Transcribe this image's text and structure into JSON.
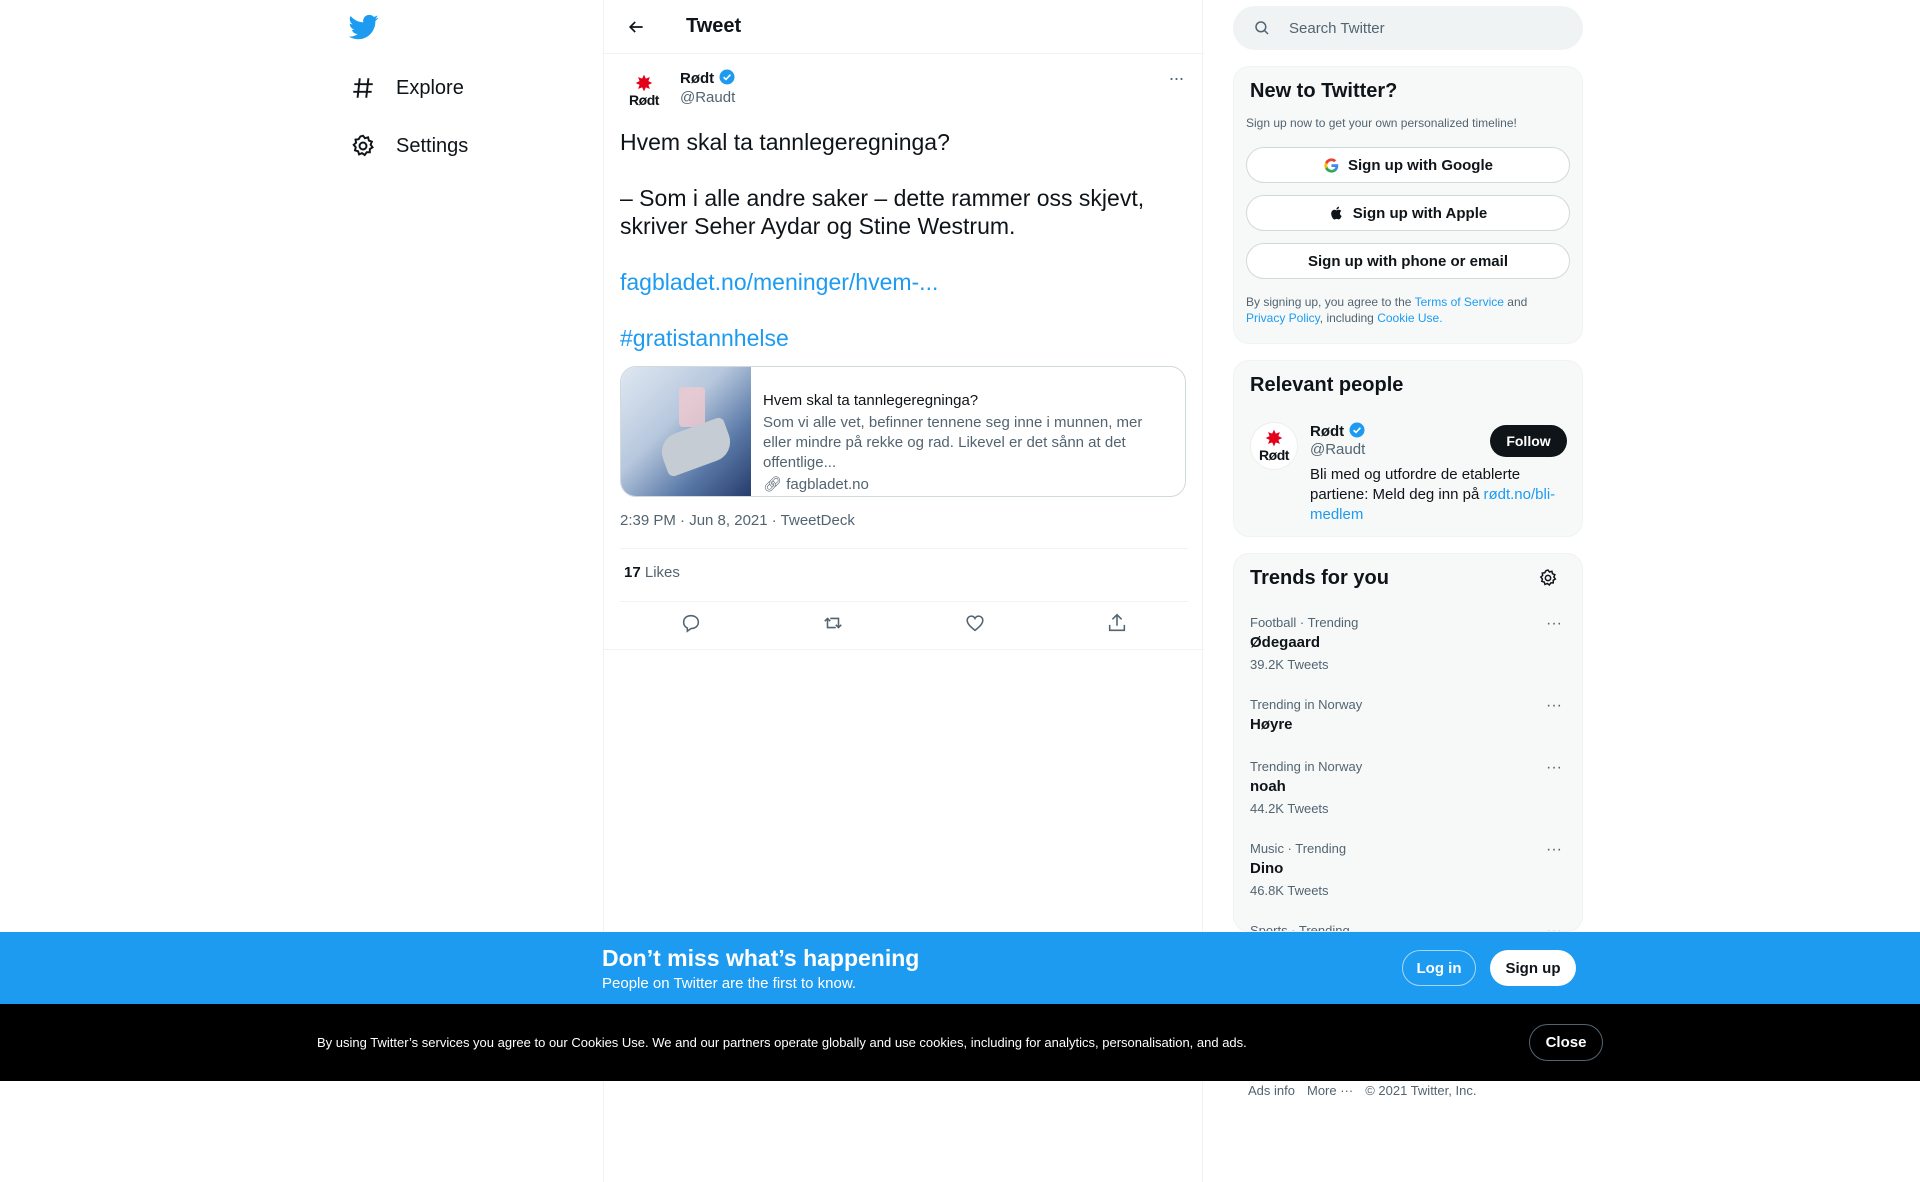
{
  "nav": {
    "explore": "Explore",
    "settings": "Settings"
  },
  "header": {
    "title": "Tweet"
  },
  "tweet": {
    "author_name": "Rødt",
    "author_handle": "@Raudt",
    "avatar_brand": "Rødt",
    "line1": "Hvem skal ta tannlegeregninga?",
    "line2": "– Som i alle andre saker – dette rammer oss skjevt,",
    "line3": "skriver Seher Aydar og Stine Westrum.",
    "link": "fagbladet.no/meninger/hvem-...",
    "hashtag": "#gratistannhelse",
    "card": {
      "title": "Hvem skal ta tannlegeregninga?",
      "description": "Som vi alle vet, befinner tennene seg inne i munnen, mer eller mindre på rekke og rad. Likevel er det sånn at det offentlige...",
      "domain": "fagbladet.no"
    },
    "time": "2:39 PM · Jun 8, 2021 · TweetDeck",
    "likes_count": "17",
    "likes_label": "Likes"
  },
  "search": {
    "placeholder": "Search Twitter"
  },
  "signup_panel": {
    "title": "New to Twitter?",
    "subtitle": "Sign up now to get your own personalized timeline!",
    "google": "Sign up with Google",
    "apple": "Sign up with Apple",
    "phone": "Sign up with phone or email",
    "legal_prefix": "By signing up, you agree to the",
    "terms": "Terms of Service",
    "and": "and",
    "privacy": "Privacy Policy",
    "including": ", including",
    "cookie": "Cookie Use."
  },
  "people_panel": {
    "title": "Relevant people",
    "name": "Rødt",
    "handle": "@Raudt",
    "follow": "Follow",
    "bio": "Bli med og utfordre de etablerte partiene: Meld deg inn på",
    "bio_link": "rødt.no/bli-medlem"
  },
  "trends_panel": {
    "title": "Trends for you",
    "items": [
      {
        "category": "Football · Trending",
        "name": "Ødegaard",
        "count": "39.2K Tweets"
      },
      {
        "category": "Trending in Norway",
        "name": "Høyre",
        "count": ""
      },
      {
        "category": "Trending in Norway",
        "name": "noah",
        "count": "44.2K Tweets"
      },
      {
        "category": "Music · Trending",
        "name": "Dino",
        "count": "46.8K Tweets"
      },
      {
        "category": "Sports · Trending",
        "name": "",
        "count": ""
      }
    ]
  },
  "footer": {
    "ads": "Ads info",
    "more": "More ···",
    "copyright": "© 2021 Twitter, Inc."
  },
  "banner": {
    "title": "Don’t miss what’s happening",
    "subtitle": "People on Twitter are the first to know.",
    "login": "Log in",
    "signup": "Sign up"
  },
  "cookie_bar": {
    "text": "By using Twitter’s services you agree to our Cookies Use. We and our partners operate globally and use cookies, including for analytics, personalisation, and ads.",
    "close": "Close"
  },
  "colors": {
    "brand": "#1d9bf0",
    "text": "#0f1419",
    "muted": "#536471",
    "rodt_red": "#e3001b"
  }
}
